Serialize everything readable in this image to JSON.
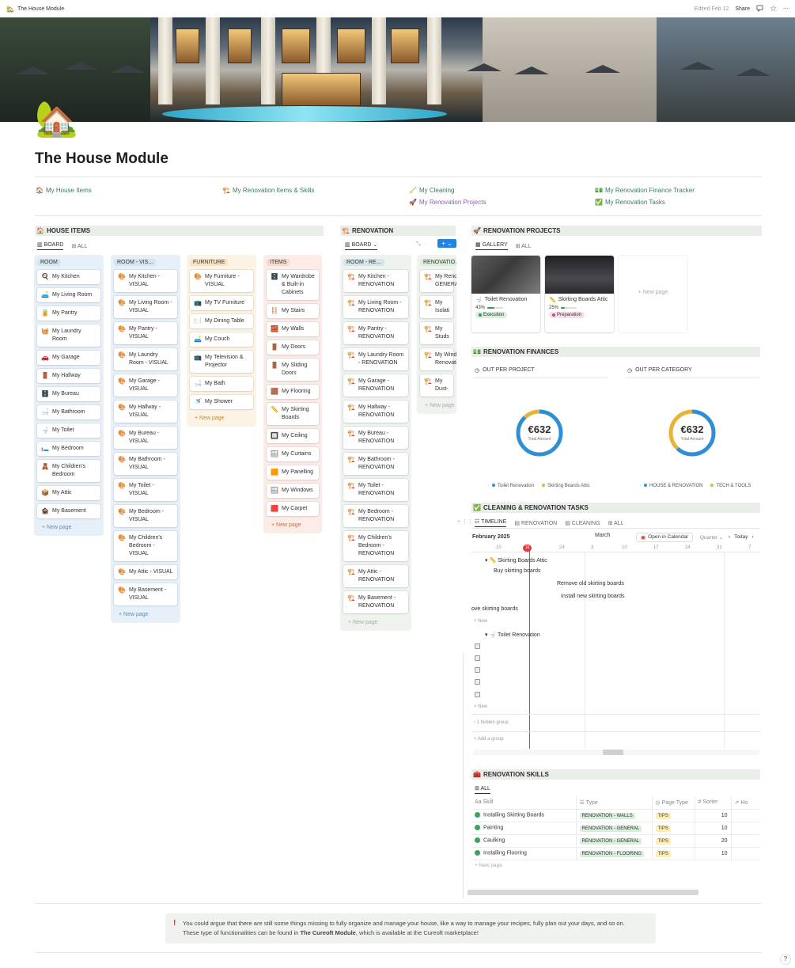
{
  "topbar": {
    "page_icon": "🏡",
    "page_title": "The House Module",
    "edited": "Edited Feb 12",
    "share": "Share"
  },
  "page": {
    "icon": "🏡",
    "title": "The House Module"
  },
  "links": [
    {
      "icon": "🏠",
      "label": "My House Items"
    },
    {
      "icon": "🏗️",
      "label": "My Renovation Items & Skills"
    },
    {
      "icon": "🧹",
      "label": "My Cleaning"
    },
    {
      "icon": "🚀",
      "label": "My Renovation Projects"
    },
    {
      "icon": "💵",
      "label": "My Renovation Finance Tracker"
    },
    {
      "icon": "✅",
      "label": "My Renovation Tasks"
    }
  ],
  "house_items": {
    "title": "HOUSE ITEMS",
    "icon": "🏠",
    "tabs": [
      "BOARD",
      "ALL"
    ],
    "new_page": "+ New page",
    "columns": [
      {
        "name": "ROOM",
        "color": "#e7f0f8",
        "tag": "#d3e5ef",
        "cards": [
          {
            "icon": "🍳",
            "label": "My Kitchen"
          },
          {
            "icon": "🛋️",
            "label": "My Living Room"
          },
          {
            "icon": "🥫",
            "label": "My Pantry"
          },
          {
            "icon": "🧺",
            "label": "My Laundry Room"
          },
          {
            "icon": "🚗",
            "label": "My Garage"
          },
          {
            "icon": "🚪",
            "label": "My Hallway"
          },
          {
            "icon": "🗄️",
            "label": "My Bureau"
          },
          {
            "icon": "🛁",
            "label": "My Bathroom"
          },
          {
            "icon": "🚽",
            "label": "My Toilet"
          },
          {
            "icon": "🛏️",
            "label": "My Bedroom"
          },
          {
            "icon": "🧸",
            "label": "My Children's Bedroom"
          },
          {
            "icon": "📦",
            "label": "My Attic"
          },
          {
            "icon": "🏚️",
            "label": "My Basement"
          }
        ]
      },
      {
        "name": "ROOM - VIS...",
        "color": "#e7f0f8",
        "tag": "#d3e5ef",
        "cards": [
          {
            "icon": "🎨",
            "label": "My Kitchen - VISUAL"
          },
          {
            "icon": "🎨",
            "label": "My Living Room - VISUAL"
          },
          {
            "icon": "🎨",
            "label": "My Pantry - VISUAL"
          },
          {
            "icon": "🎨",
            "label": "My Laundry Room - VISUAL"
          },
          {
            "icon": "🎨",
            "label": "My Garage - VISUAL"
          },
          {
            "icon": "🎨",
            "label": "My Hallway - VISUAL"
          },
          {
            "icon": "🎨",
            "label": "My Bureau - VISUAL"
          },
          {
            "icon": "🎨",
            "label": "My Bathroom - VISUAL"
          },
          {
            "icon": "🎨",
            "label": "My Toilet - VISUAL"
          },
          {
            "icon": "🎨",
            "label": "My Bedroom - VISUAL"
          },
          {
            "icon": "🎨",
            "label": "My Children's Bedroom - VISUAL"
          },
          {
            "icon": "🎨",
            "label": "My Attic - VISUAL"
          },
          {
            "icon": "🎨",
            "label": "My Basement - VISUAL"
          }
        ]
      },
      {
        "name": "FURNITURE",
        "color": "#fbf3e4",
        "tag": "#fae3c0",
        "cards": [
          {
            "icon": "🎨",
            "label": "My Furniture - VISUAL"
          },
          {
            "icon": "📺",
            "label": "My TV Furniture"
          },
          {
            "icon": "🍽️",
            "label": "My Dining Table"
          },
          {
            "icon": "🛋️",
            "label": "My Couch"
          },
          {
            "icon": "📺",
            "label": "My Television & Projector"
          },
          {
            "icon": "🛁",
            "label": "My Bath"
          },
          {
            "icon": "🚿",
            "label": "My Shower"
          }
        ]
      },
      {
        "name": "ITEMS",
        "color": "#fbece7",
        "tag": "#f8d8cc",
        "cards": [
          {
            "icon": "🗄️",
            "label": "My Wardrobe & Built-in Cabinets"
          },
          {
            "icon": "🪜",
            "label": "My Stairs"
          },
          {
            "icon": "🧱",
            "label": "My Walls"
          },
          {
            "icon": "🚪",
            "label": "My Doors"
          },
          {
            "icon": "🚪",
            "label": "My Sliding Doors"
          },
          {
            "icon": "🟫",
            "label": "My Flooring"
          },
          {
            "icon": "📏",
            "label": "My Skirting Boards"
          },
          {
            "icon": "🔲",
            "label": "My Ceiling"
          },
          {
            "icon": "🪟",
            "label": "My Curtains"
          },
          {
            "icon": "🟧",
            "label": "My Panelling"
          },
          {
            "icon": "🪟",
            "label": "My Windows"
          },
          {
            "icon": "🟥",
            "label": "My Carpet"
          }
        ]
      }
    ]
  },
  "renovation": {
    "title": "RENOVATION",
    "icon": "🏗️",
    "tab": "BOARD",
    "new_page": "+ New page",
    "columns": [
      {
        "name": "ROOM - RE...",
        "cards": [
          "My Kitchen - RENOVATION",
          "My Living Room - RENOVATION",
          "My Pantry - RENOVATION",
          "My Laundry Room - RENOVATION",
          "My Garage - RENOVATION",
          "My Hallway - RENOVATION",
          "My Bureau - RENOVATION",
          "My Bathroom - RENOVATION",
          "My Toilet - RENOVATION",
          "My Bedroom - RENOVATION",
          "My Children's Bedroom - RENOVATION",
          "My Attic - RENOVATION",
          "My Basement - RENOVATION"
        ]
      },
      {
        "name": "RENOVATIO...",
        "cards": [
          "My Renov GENERAL",
          "My Isolati",
          "My Studs",
          "My Windo Renovatic",
          "My Dust-"
        ]
      }
    ]
  },
  "projects": {
    "title": "RENOVATION PROJECTS",
    "icon": "🚀",
    "tabs": [
      "GALLERY",
      "ALL"
    ],
    "new_page": "+ New page",
    "cards": [
      {
        "icon": "🚽",
        "title": "Toilet Renovation",
        "progress_label": "43%",
        "progress": 0.43,
        "status": "Execution",
        "status_bg": "#dbeddb",
        "status_color": "#1c3829",
        "dot": "#2a9d5a"
      },
      {
        "icon": "📏",
        "title": "Skirting Boards Attic",
        "progress_label": "25%",
        "progress": 0.25,
        "status": "Preparation",
        "status_bg": "#f5e0e9",
        "status_color": "#4c2337",
        "dot": "#c14c8a"
      }
    ]
  },
  "finances": {
    "title": "RENOVATION FINANCES",
    "icon": "💵",
    "charts": [
      {
        "title": "OUT PER PROJECT",
        "value": "€632",
        "sub": "Total Amount",
        "slices": [
          {
            "name": "Toilet Renovation",
            "color": "#2e8fd6",
            "value": 0.88
          },
          {
            "name": "Skirting Boards Attic",
            "color": "#e8b33a",
            "value": 0.12
          }
        ]
      },
      {
        "title": "OUT PER CATEGORY",
        "value": "€632",
        "sub": "Total Amount",
        "slices": [
          {
            "name": "HOUSE & RENOVATION",
            "color": "#2e8fd6",
            "value": 0.62
          },
          {
            "name": "TECH & TOOLS",
            "color": "#e8b33a",
            "value": 0.38
          }
        ]
      }
    ]
  },
  "tasks": {
    "title": "CLEANING & RENOVATION TASKS",
    "icon": "✅",
    "tabs": [
      "TIMELINE",
      "RENOVATION",
      "CLEANING",
      "ALL"
    ],
    "month1": "February 2025",
    "month2": "March",
    "open_cal": "Open in Calendar",
    "range": "Quarter",
    "today": "Today",
    "ticks": [
      "10",
      "16",
      "24",
      "3",
      "10",
      "17",
      "24",
      "31",
      "7"
    ],
    "group1": "Skirting Boards Attic",
    "group2": "Toilet Renovation",
    "items": [
      "Buy skirting boards",
      "Remove old skirting boards",
      "Install new skirting boards",
      "ove skirting boards"
    ],
    "new": "+ New",
    "hidden": "1 hidden group",
    "add_group": "+ Add a group"
  },
  "skills": {
    "title": "RENOVATION SKILLS",
    "icon": "🧰",
    "tab": "ALL",
    "headers": [
      "Aa Skill",
      "Type",
      "Page Type",
      "# Sorter",
      "Ho"
    ],
    "rows": [
      {
        "skill": "Installing Skirting Boards",
        "type": "RENOVATION - WALLS",
        "ptype": "TIPS",
        "sorter": "10"
      },
      {
        "skill": "Painting",
        "type": "RENOVATION - GENERAL",
        "ptype": "TIPS",
        "sorter": "10"
      },
      {
        "skill": "Caulking",
        "type": "RENOVATION - GENERAL",
        "ptype": "TIPS",
        "sorter": "20"
      },
      {
        "skill": "Installing Flooring",
        "type": "RENOVATION - FLOORING",
        "ptype": "TIPS",
        "sorter": "10"
      }
    ],
    "new_page": "+ New page"
  },
  "callout": {
    "icon": "!",
    "line1": "You could argue that there are still some things missing to fully organize and manage your house, like a way to manage your recipes, fully plan out your days, and so on.",
    "line2a": "These type of functionalities can be found in ",
    "line2b": "The Cureoft Module",
    "line2c": ", which is available at the Cureoft marketplace!"
  }
}
